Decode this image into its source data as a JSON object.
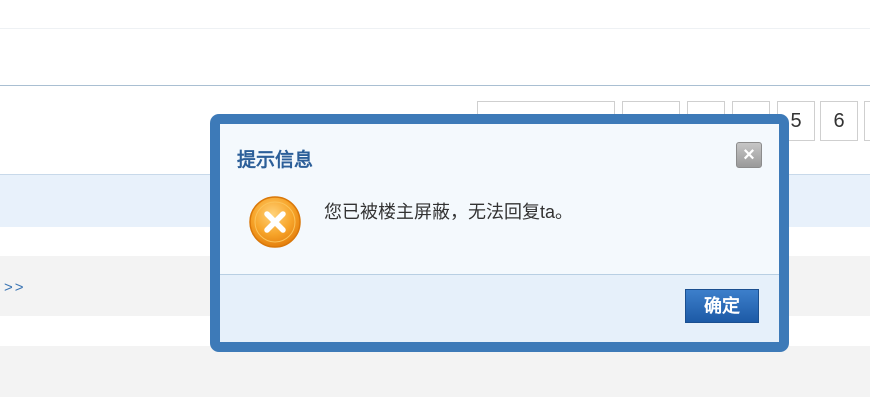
{
  "background": {
    "more_link": ">>",
    "pagination": [
      "5",
      "6"
    ]
  },
  "dialog": {
    "title": "提示信息",
    "close_label": "×",
    "message": "您已被楼主屏蔽，无法回复ta。",
    "icon": "error-x-icon",
    "confirm_label": "确定"
  },
  "colors": {
    "dialog_border": "#3d7ab8",
    "title": "#2c5f99",
    "confirm_button": "#2563ae",
    "error_icon": "#f39a1d"
  }
}
